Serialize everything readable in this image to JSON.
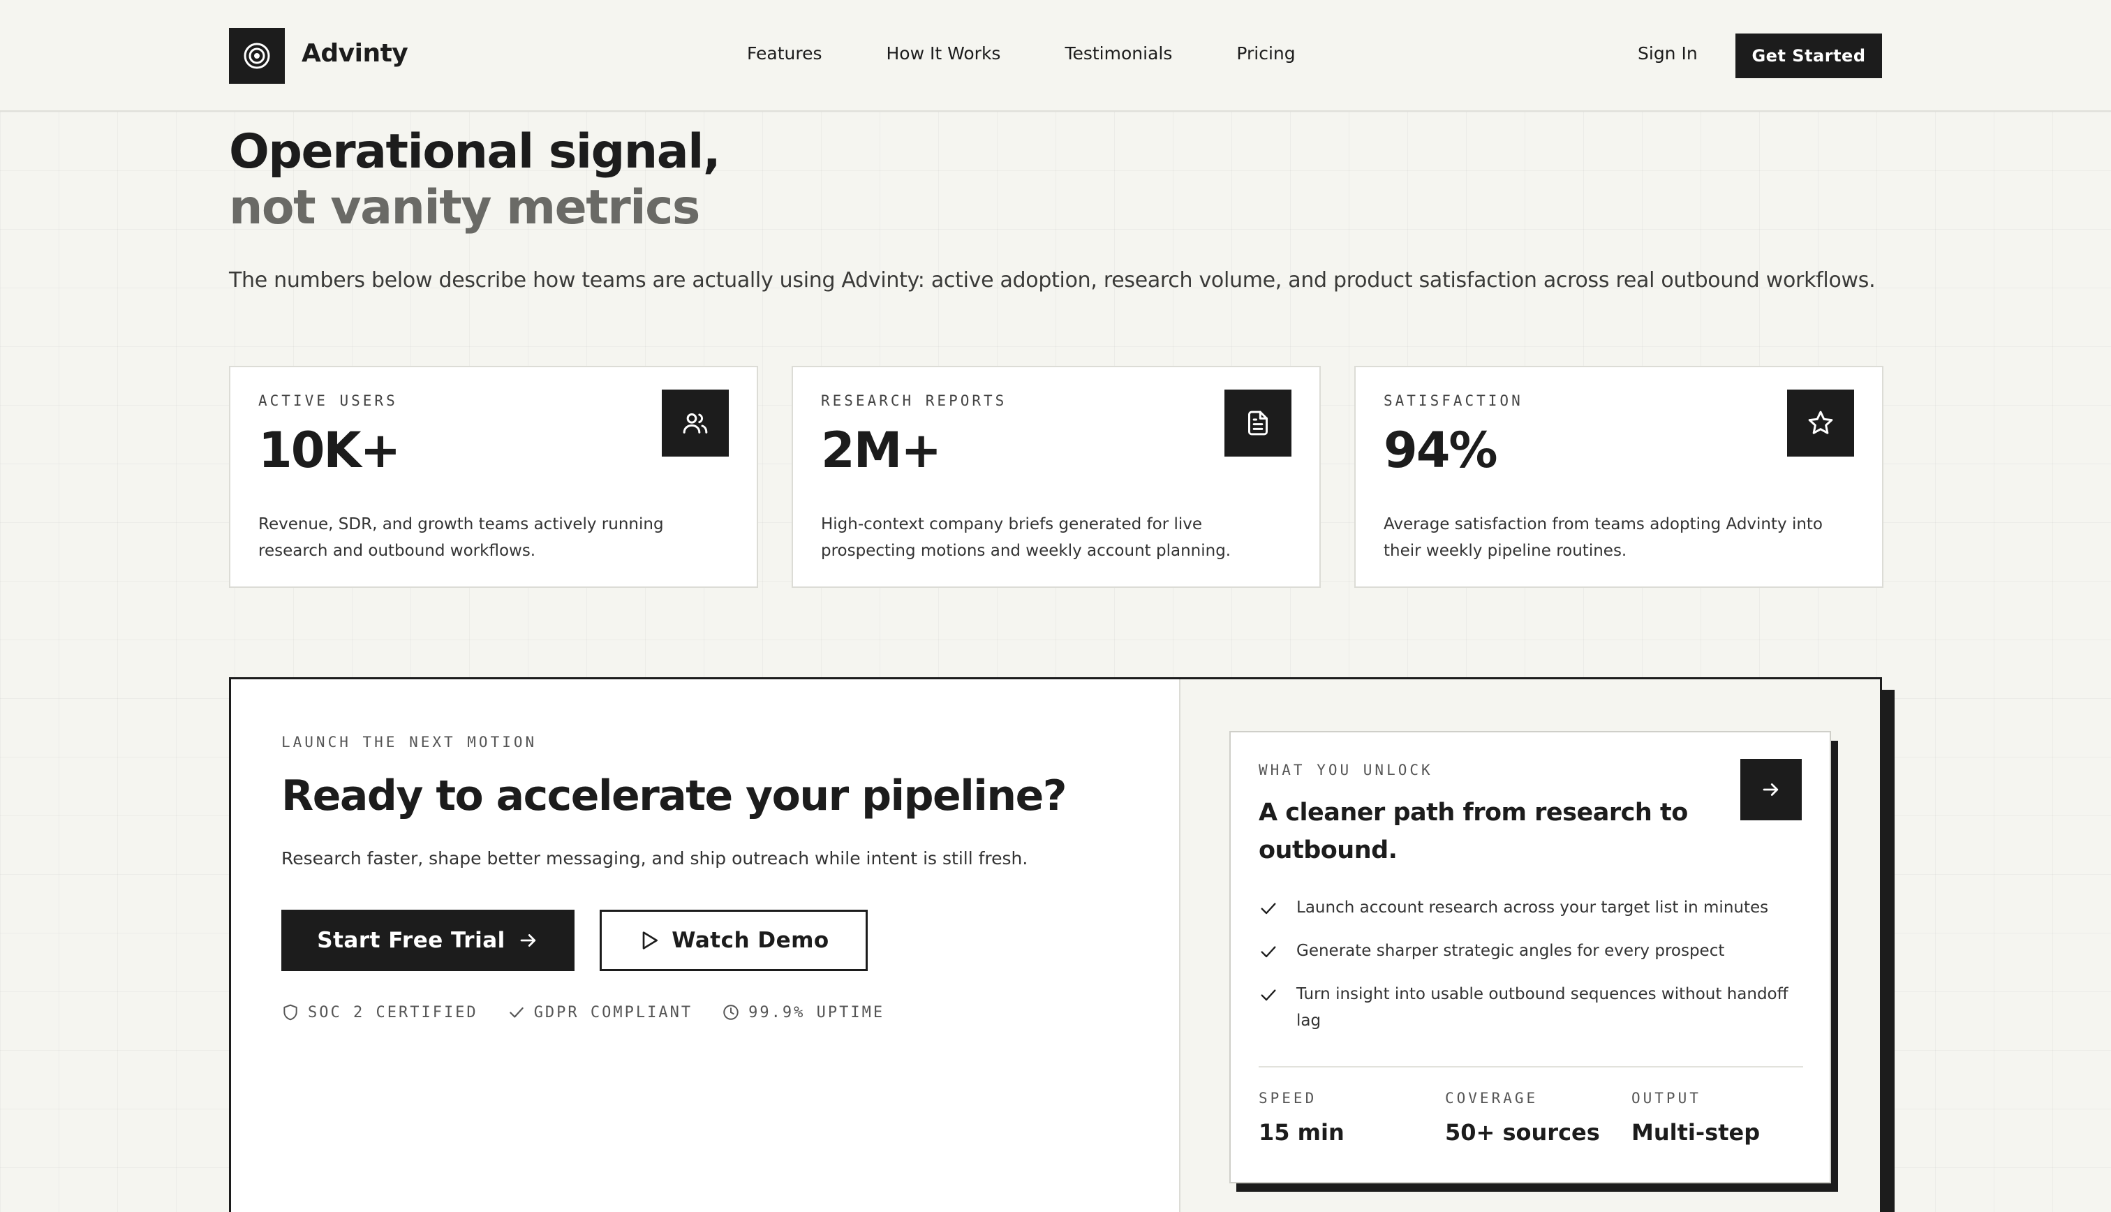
{
  "nav": {
    "brand": "Advinty",
    "links": [
      "Features",
      "How It Works",
      "Testimonials",
      "Pricing"
    ],
    "sign_in": "Sign In",
    "get_started": "Get Started"
  },
  "hero": {
    "title_line1": "Operational signal,",
    "title_line2": "not vanity metrics",
    "lead": "The numbers below describe how teams are actually using Advinty: active adoption, research volume, and product satisfaction across real outbound workflows."
  },
  "stats": [
    {
      "label": "ACTIVE USERS",
      "value": "10K+",
      "icon": "users-icon",
      "desc": "Revenue, SDR, and growth teams actively running research and outbound workflows."
    },
    {
      "label": "RESEARCH REPORTS",
      "value": "2M+",
      "icon": "document-icon",
      "desc": "High-context company briefs generated for live prospecting motions and weekly account planning."
    },
    {
      "label": "SATISFACTION",
      "value": "94%",
      "icon": "star-icon",
      "desc": "Average satisfaction from teams adopting Advinty into their weekly pipeline routines."
    }
  ],
  "cta": {
    "label": "LAUNCH THE NEXT MOTION",
    "title": "Ready to accelerate your pipeline?",
    "subtitle": "Research faster, shape better messaging, and ship outreach while intent is still fresh.",
    "primary": "Start Free Trial",
    "secondary": "Watch Demo",
    "badges": [
      {
        "icon": "shield-icon",
        "text": "SOC 2 CERTIFIED"
      },
      {
        "icon": "check-icon",
        "text": "GDPR COMPLIANT"
      },
      {
        "icon": "clock-icon",
        "text": "99.9% UPTIME"
      }
    ]
  },
  "unlock": {
    "label": "WHAT YOU UNLOCK",
    "title": "A cleaner path from research to outbound.",
    "items": [
      "Launch account research across your target list in minutes",
      "Generate sharper strategic angles for every prospect",
      "Turn insight into usable outbound sequences without handoff lag"
    ],
    "metrics": [
      {
        "label": "SPEED",
        "value": "15 min"
      },
      {
        "label": "COVERAGE",
        "value": "50+ sources"
      },
      {
        "label": "OUTPUT",
        "value": "Multi-step"
      }
    ]
  },
  "colors": {
    "ink": "#1c1c1c",
    "background": "#f5f5f0",
    "muted": "#6a6a66"
  }
}
